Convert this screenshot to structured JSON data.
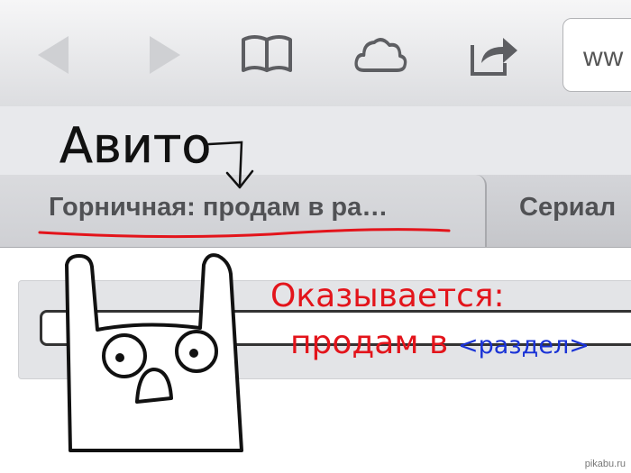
{
  "toolbar": {
    "back_icon": "back-arrow-icon",
    "forward_icon": "forward-arrow-icon",
    "bookmarks_icon": "bookmarks-book-icon",
    "icloud_icon": "icloud-cloud-icon",
    "share_icon": "share-icon",
    "url_text": "ww"
  },
  "tabs": [
    {
      "title": "Горничная: продам в ра…",
      "active": true
    },
    {
      "title": "Сериал",
      "active": false
    }
  ],
  "annotations": {
    "avito_label": "Авито",
    "realization_line1": "Оказывается:",
    "realization_line2": "продам в",
    "section_placeholder": "<раздел>"
  },
  "watermark": "pikabu.ru",
  "colors": {
    "ink": "#111111",
    "red_marker": "#e3141b",
    "blue_marker": "#1a33d6"
  }
}
